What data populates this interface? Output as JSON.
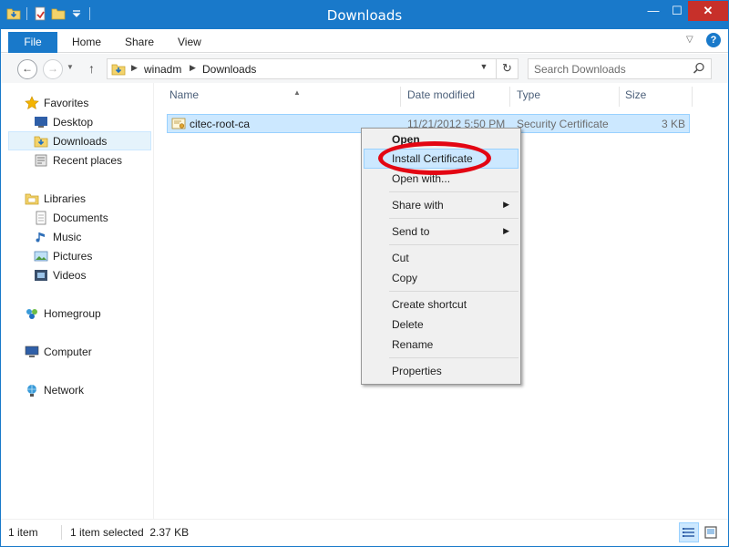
{
  "window": {
    "title": "Downloads",
    "buttons": {
      "minimize": "—",
      "maximize": "☐",
      "close": "✕"
    }
  },
  "ribbon": {
    "file_tab": "File",
    "tabs": [
      "Home",
      "Share",
      "View"
    ],
    "help": "?"
  },
  "address": {
    "crumbs": [
      "winadm",
      "Downloads"
    ],
    "search_placeholder": "Search Downloads"
  },
  "navpane": {
    "favorites": "Favorites",
    "favorites_items": [
      "Desktop",
      "Downloads",
      "Recent places"
    ],
    "libraries": "Libraries",
    "libraries_items": [
      "Documents",
      "Music",
      "Pictures",
      "Videos"
    ],
    "homegroup": "Homegroup",
    "computer": "Computer",
    "network": "Network"
  },
  "filelist": {
    "columns": {
      "name": "Name",
      "date": "Date modified",
      "type": "Type",
      "size": "Size"
    },
    "rows": [
      {
        "name": "citec-root-ca",
        "date": "11/21/2012 5:50 PM",
        "type": "Security Certificate",
        "size": "3 KB"
      }
    ]
  },
  "context_menu": {
    "items": {
      "open": "Open",
      "install": "Install Certificate",
      "open_with": "Open with...",
      "share_with": "Share with",
      "send_to": "Send to",
      "cut": "Cut",
      "copy": "Copy",
      "create_shortcut": "Create shortcut",
      "delete": "Delete",
      "rename": "Rename",
      "properties": "Properties"
    },
    "highlight_color": "#e30613"
  },
  "statusbar": {
    "item_count": "1 item",
    "selection": "1 item selected  2.37 KB"
  },
  "colors": {
    "accent": "#1979ca",
    "selection": "#cce8ff",
    "close_button": "#c7302a"
  }
}
